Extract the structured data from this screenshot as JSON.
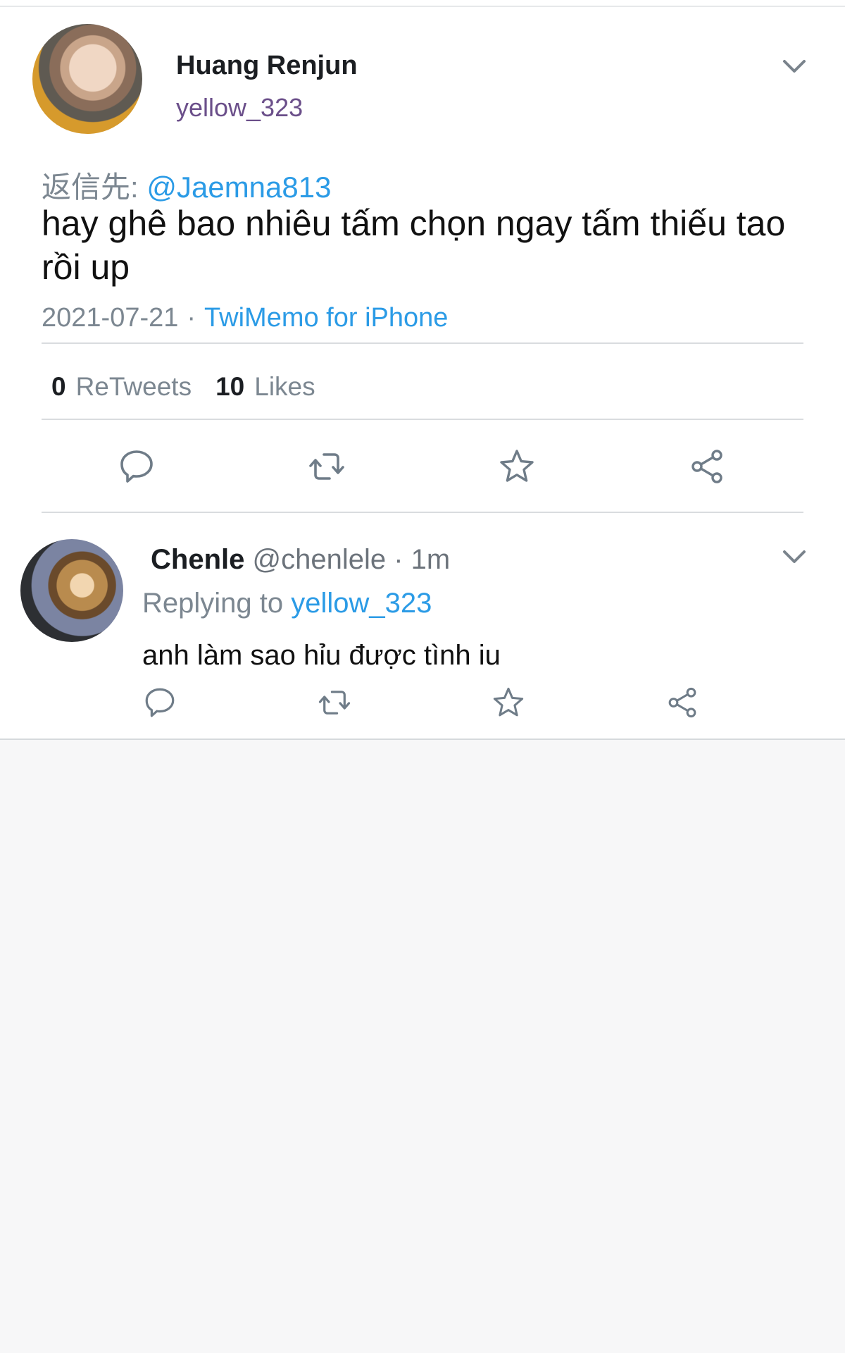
{
  "tweet": {
    "display_name": "Huang Renjun",
    "handle": "yellow_323",
    "reply_prefix": "返信先: ",
    "reply_to": "@Jaemna813",
    "text": "hay ghê bao nhiêu tấm chọn ngay tấm thiếu tao rồi up",
    "date": "2021-07-21",
    "separator": "·",
    "source": "TwiMemo for iPhone",
    "retweets_count": "0",
    "retweets_label": "ReTweets",
    "likes_count": "10",
    "likes_label": "Likes"
  },
  "reply": {
    "display_name": "Chenle",
    "handle": "@chenlele",
    "time": "· 1m",
    "replying_label": "Replying to ",
    "replying_to": "yellow_323",
    "text": "anh làm sao hỉu được tình iu"
  },
  "icons": {
    "reply": "speech-bubble-icon",
    "retweet": "retweet-icon",
    "like": "star-icon",
    "share": "share-icon",
    "menu": "chevron-down-icon"
  },
  "colors": {
    "link": "#2b9be6",
    "muted": "#7c8791",
    "icon": "#6f7c88"
  }
}
